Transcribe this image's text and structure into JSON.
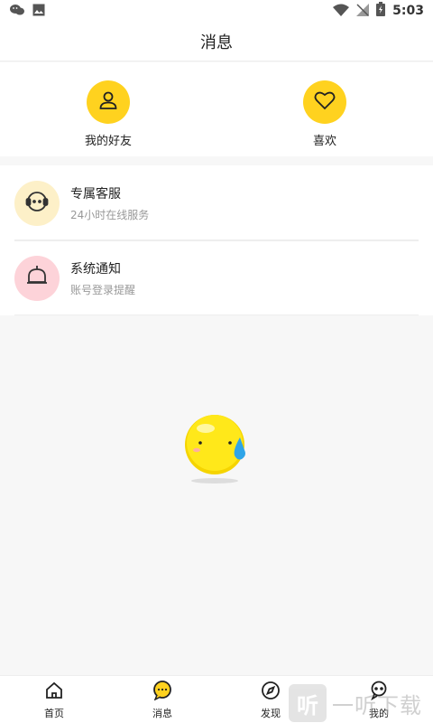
{
  "status_bar": {
    "time": "5:03"
  },
  "header": {
    "title": "消息"
  },
  "quick": [
    {
      "label": "我的好友",
      "icon": "person-icon"
    },
    {
      "label": "喜欢",
      "icon": "heart-icon"
    }
  ],
  "list": [
    {
      "title": "专属客服",
      "subtitle": "24小时在线服务",
      "icon": "headset-icon"
    },
    {
      "title": "系统通知",
      "subtitle": "账号登录提醒",
      "icon": "bell-icon"
    }
  ],
  "tabs": [
    {
      "label": "首页",
      "icon": "home-icon"
    },
    {
      "label": "消息",
      "icon": "message-icon",
      "active": true
    },
    {
      "label": "发现",
      "icon": "compass-icon"
    },
    {
      "label": "我的",
      "icon": "profile-icon"
    }
  ],
  "watermark": {
    "badge": "听",
    "text": "一听下载"
  },
  "colors": {
    "accent": "#ffd21f",
    "service_bg": "#fdf0c8",
    "notice_bg": "#fdd3d9"
  }
}
